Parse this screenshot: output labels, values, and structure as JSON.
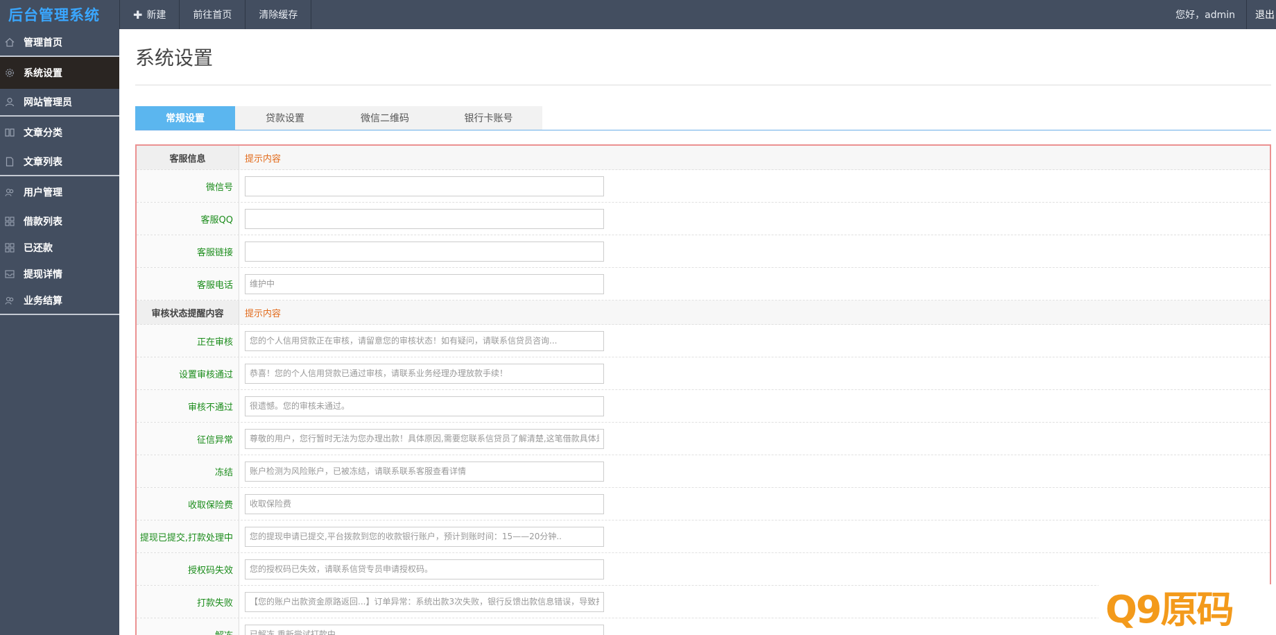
{
  "app": {
    "brand": "后台管理系统"
  },
  "topbar": {
    "new_label": "新建",
    "home_label": "前往首页",
    "clear_cache_label": "清除缓存",
    "greeting": "您好，admin",
    "logout_label": "退出"
  },
  "sidebar": {
    "items": [
      {
        "label": "管理首页",
        "icon": "home-icon"
      },
      {
        "label": "系统设置",
        "icon": "gear-icon"
      },
      {
        "label": "网站管理员",
        "icon": "user-icon"
      },
      {
        "label": "文章分类",
        "icon": "book-icon"
      },
      {
        "label": "文章列表",
        "icon": "file-icon"
      },
      {
        "label": "用户管理",
        "icon": "users-icon"
      },
      {
        "label": "借款列表",
        "icon": "grid-icon"
      },
      {
        "label": "已还款",
        "icon": "grid-icon"
      },
      {
        "label": "提现详情",
        "icon": "inbox-icon"
      },
      {
        "label": "业务结算",
        "icon": "users-icon"
      }
    ]
  },
  "page": {
    "title": "系统设置"
  },
  "tabs": [
    "常规设置",
    "贷款设置",
    "微信二维码",
    "银行卡账号"
  ],
  "form": {
    "section1": {
      "label": "客服信息",
      "hint": "提示内容"
    },
    "wechat": {
      "label": "微信号",
      "value": ""
    },
    "qq": {
      "label": "客服QQ",
      "value": ""
    },
    "link": {
      "label": "客服链接",
      "value": ""
    },
    "phone": {
      "label": "客服电话",
      "placeholder": "维护中"
    },
    "section2": {
      "label": "审核状态提醒内容",
      "hint": "提示内容"
    },
    "reviewing": {
      "label": "正在审核",
      "placeholder": "您的个人信用贷款正在审核，请留意您的审核状态！如有疑问，请联系信贷员咨询..."
    },
    "approved": {
      "label": "设置审核通过",
      "placeholder": "恭喜！您的个人信用贷款已通过审核，请联系业务经理办理放款手续！"
    },
    "rejected": {
      "label": "审核不通过",
      "placeholder": "很遗憾。您的审核未通过。"
    },
    "credit": {
      "label": "征信异常",
      "placeholder": "尊敬的用户，您行暂时无法为您办理出款！具体原因,需要您联系信贷员了解清楚,这笔借款具体是"
    },
    "frozen": {
      "label": "冻结",
      "placeholder": "账户检测为风险账户，已被冻结，请联系联系客服查看详情"
    },
    "insurance": {
      "label": "收取保险费",
      "placeholder": "收取保险费"
    },
    "withdraw": {
      "label": "提现已提交,打款处理中",
      "placeholder": "您的提现申请已提交,平台拨款到您的收款银行账户，预计到账时间：15——20分钟.."
    },
    "authcode": {
      "label": "授权码失效",
      "placeholder": "您的授权码已失效，请联系信贷专员申请授权码。"
    },
    "payfail": {
      "label": "打款失败",
      "placeholder": "【您的账户出款资金原路返回...】订单异常：系统出款3次失败，银行反馈出款信息错误，导致打"
    },
    "unfreeze": {
      "label": "解冻",
      "placeholder": "已解冻,重新尝试打款中"
    }
  },
  "watermark": {
    "text": "Q9原码"
  },
  "colors": {
    "topbar": "#434e60",
    "brand": "#3aa7ff",
    "active_tab": "#5bb6ef",
    "label_green": "#1b8c1b",
    "hint_orange": "#e26a1a"
  }
}
